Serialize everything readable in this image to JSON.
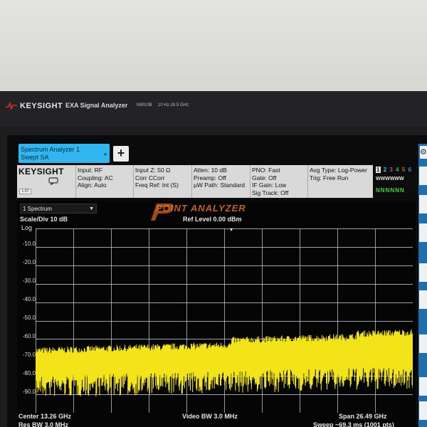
{
  "instrument": {
    "brand": "KEYSIGHT",
    "title": "EXA Signal Analyzer",
    "model": "N9010B",
    "range": "10 Hz-26.5 GHz"
  },
  "tabs": {
    "active_line1": "Spectrum Analyzer 1",
    "active_line2": "Swept SA",
    "add_label": "+"
  },
  "info_bar": {
    "brand": "KEYSIGHT",
    "lxi": "LXI",
    "col1": [
      "Input: RF",
      "Coupling: AC",
      "Align: Auto"
    ],
    "col2": [
      "Input Z: 50 Ω",
      "Corr CCorr",
      "Freq Ref: Int (S)"
    ],
    "col3": [
      "Atten: 10 dB",
      "Preamp: Off",
      "µW Path: Standard"
    ],
    "col4": [
      "PNO: Fast",
      "Gate: Off",
      "IF Gain: Low",
      "Sig Track: Off"
    ],
    "col5": [
      "Avg Type: Log-Power",
      "Trig: Free Run"
    ]
  },
  "trace_indicator": {
    "numbers": [
      "1",
      "2",
      "3",
      "4",
      "5",
      "6"
    ],
    "types": "WWWWWW",
    "detectors": "NNNNNN",
    "number_colors": [
      "#f2e600",
      "#38c8e6",
      "#c23ccb",
      "#3db23d",
      "#e0503a",
      "#3a8ee0"
    ]
  },
  "watermark": "POINT ANALYZER",
  "plot": {
    "window_select": "1 Spectrum",
    "scale": "Scale/Div 10 dB",
    "ref_level": "Ref Level 0.00 dBm",
    "log": "Log",
    "y_ticks": [
      "-10.0",
      "-20.0",
      "-30.0",
      "-40.0",
      "-50.0",
      "-60.0",
      "-70.0",
      "-80.0",
      "-90.0"
    ],
    "trace_color": "#f2e418",
    "grid_color": "#d8d8d8"
  },
  "footer": {
    "center": "Center 13.26 GHz",
    "res_bw": "Res BW 3.0 MHz",
    "video_bw": "Video BW 3.0 MHz",
    "span": "Span 26.49 GHz",
    "sweep": "Sweep ~69.3 ms (1001 pts)"
  }
}
